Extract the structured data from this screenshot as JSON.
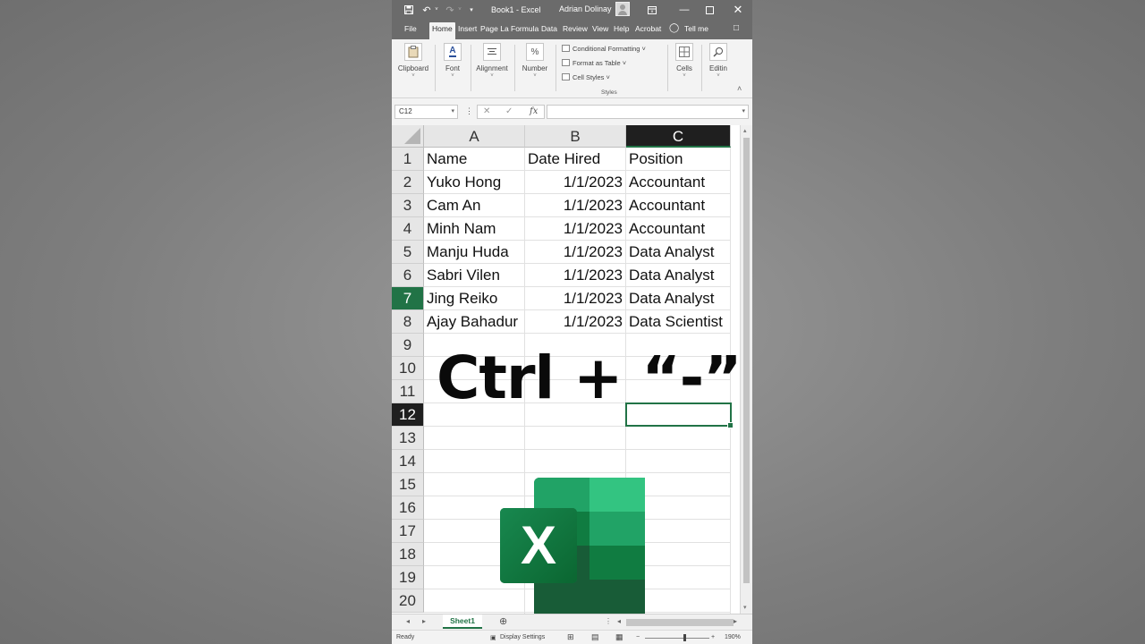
{
  "titlebar": {
    "title": "Book1  -  Excel",
    "user": "Adrian Dolinay",
    "icons": [
      "save-icon",
      "undo-icon",
      "redo-icon",
      "customize-icon",
      "ribbon-display-icon",
      "minimize-icon",
      "maximize-icon",
      "close-icon"
    ]
  },
  "tabs": [
    "File",
    "Home",
    "Insert",
    "Page La",
    "Formula",
    "Data",
    "Review",
    "View",
    "Help",
    "Acrobat",
    "Tell me"
  ],
  "ribbon": {
    "clipboard": "Clipboard",
    "font": "Font",
    "alignment": "Alignment",
    "number": "Number",
    "number_symbol": "%",
    "conditional_formatting": "Conditional Formatting ˅",
    "format_as_table": "Format as Table ˅",
    "cell_styles": "Cell Styles ˅",
    "styles_label": "Styles",
    "cells": "Cells",
    "editing": "Editin"
  },
  "formula_bar": {
    "name_box": "C12",
    "formula": ""
  },
  "columns": [
    "A",
    "B",
    "C"
  ],
  "selected_column": "C",
  "rows": [
    "1",
    "2",
    "3",
    "4",
    "5",
    "6",
    "7",
    "8",
    "9",
    "10",
    "11",
    "12",
    "13",
    "14",
    "15",
    "16",
    "17",
    "18",
    "19",
    "20"
  ],
  "table": [
    [
      "Name",
      "Date Hired",
      "Position"
    ],
    [
      "Yuko Hong",
      "1/1/2023",
      "Accountant"
    ],
    [
      "Cam An",
      "1/1/2023",
      "Accountant"
    ],
    [
      "Minh Nam",
      "1/1/2023",
      "Accountant"
    ],
    [
      "Manju Huda",
      "1/1/2023",
      "Data Analyst"
    ],
    [
      "Sabri Vilen",
      "1/1/2023",
      "Data Analyst"
    ],
    [
      "Jing Reiko",
      "1/1/2023",
      "Data Analyst"
    ],
    [
      "Ajay Bahadur",
      "1/1/2023",
      "Data Scientist"
    ]
  ],
  "overlay": "Ctrl + “-”",
  "active_cell": "C12",
  "logo_letter": "X",
  "sheet_tab": "Sheet1",
  "status": {
    "ready": "Ready",
    "display_settings": "Display Settings",
    "zoom": "190%"
  },
  "colors": {
    "excel_green": "#217346",
    "title_bar": "#6b6b6b",
    "ribbon_bg": "#f3f3f3"
  }
}
